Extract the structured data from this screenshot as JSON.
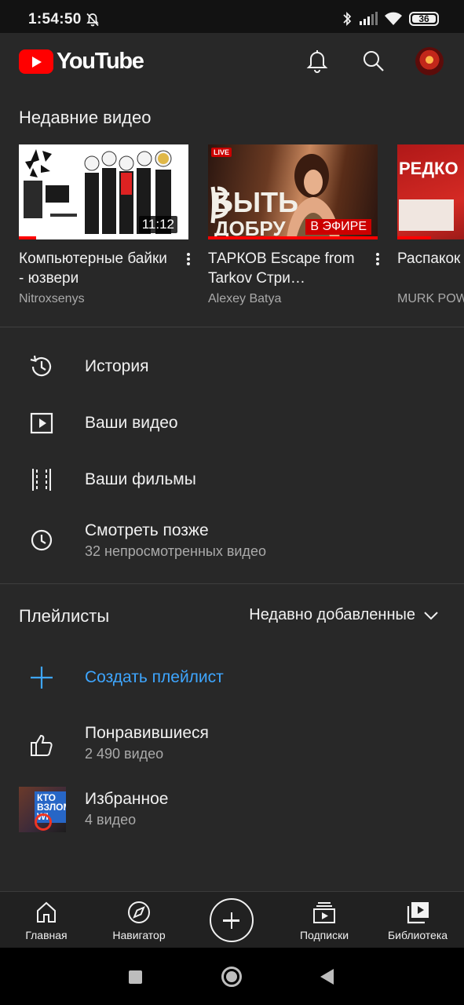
{
  "status_bar": {
    "time": "1:54:50",
    "battery": "36"
  },
  "header": {
    "logo_text": "YouTube",
    "icons": [
      "bell-icon",
      "search-icon",
      "avatar"
    ]
  },
  "recent": {
    "title": "Недавние видео",
    "videos": [
      {
        "title": "Компьютерные байки - юзвери",
        "channel": "Nitroxsenys",
        "duration": "11:12",
        "watched_fraction": 0.1
      },
      {
        "title": "ТАРКОВ Escape from Tarkov Стри…",
        "channel": "Alexey Batya",
        "live_badge": "LIVE",
        "live_label": "В ЭФИРЕ",
        "watched_fraction": 1.0
      },
      {
        "title": "Распакок посылок",
        "channel": "MURK POW",
        "thumb_text": "РЕДКО",
        "watched_fraction": 0.2
      }
    ]
  },
  "menu": [
    {
      "label": "История",
      "icon": "history-icon"
    },
    {
      "label": "Ваши видео",
      "icon": "play-box-icon"
    },
    {
      "label": "Ваши фильмы",
      "icon": "film-strip-icon"
    },
    {
      "label": "Смотреть позже",
      "sub": "32 непросмотренных видео",
      "icon": "clock-icon"
    }
  ],
  "playlists": {
    "title": "Плейлисты",
    "sort_label": "Недавно добавленные",
    "create_label": "Создать плейлист",
    "items": [
      {
        "label": "Понравившиеся",
        "sub": "2 490 видео",
        "icon": "thumbs-up-icon"
      },
      {
        "label": "Избранное",
        "sub": "4 видео",
        "thumb_text": "КТО ВЗЛОМ WI"
      }
    ]
  },
  "bottom_nav": {
    "home": "Главная",
    "explore": "Навигатор",
    "subscriptions": "Подписки",
    "library": "Библиотека"
  },
  "colors": {
    "background": "#282828",
    "accent_blue": "#3ea6ff",
    "brand_red": "#ff0000"
  }
}
